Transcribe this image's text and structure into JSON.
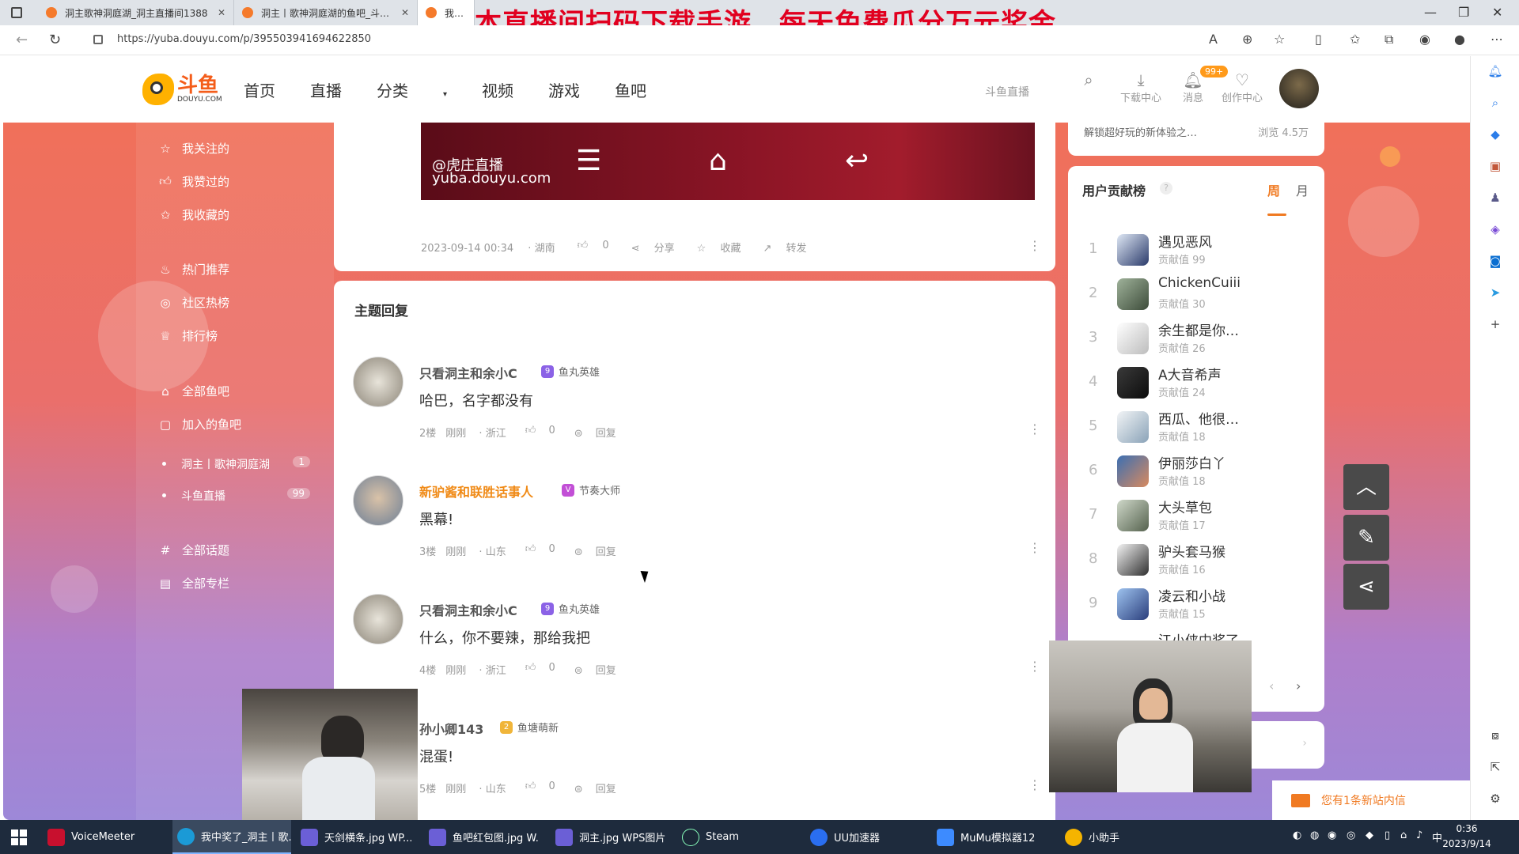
{
  "browser": {
    "tabs": [
      {
        "title": "洞主歌神洞庭湖_洞主直播间1388"
      },
      {
        "title": "洞主丨歌神洞庭湖的鱼吧_斗鱼鱼"
      },
      {
        "title": "我中奖了_洞"
      }
    ],
    "url": "https://yuba.douyu.com/p/395503941694622850",
    "overlay_banner": "本直播间扫码下载手游，每天免费瓜分万元奖金"
  },
  "header": {
    "logo_cn": "斗鱼",
    "logo_en": "DOUYU.COM",
    "nav": [
      "首页",
      "直播",
      "分类",
      "视频",
      "游戏",
      "鱼吧"
    ],
    "live_link": "斗鱼直播",
    "download_label": "下载中心",
    "message_label": "消息",
    "message_badge": "99+",
    "creator_label": "创作中心"
  },
  "sidebar": {
    "group1": [
      "我关注的",
      "我赞过的",
      "我收藏的"
    ],
    "group2": [
      "热门推荐",
      "社区热榜",
      "排行榜"
    ],
    "group3": [
      "全部鱼吧",
      "加入的鱼吧"
    ],
    "joined": [
      {
        "name": "洞主丨歌神洞庭湖",
        "count": "1"
      },
      {
        "name": "斗鱼直播",
        "count": "99"
      }
    ],
    "group4": [
      "全部话题",
      "全部专栏"
    ]
  },
  "post": {
    "watermark_1": "@虎庄直播",
    "watermark_2": "yuba.douyu.com",
    "time": "2023-09-14 00:34",
    "location": "湖南",
    "likes": "0",
    "share": "分享",
    "collect": "收藏",
    "forward": "转发"
  },
  "replies": {
    "title": "主题回复",
    "items": [
      {
        "name": "只看洞主和余小C",
        "badge": "鱼丸英雄",
        "text": "哈巴，名字都没有",
        "floor": "2楼",
        "time": "刚刚",
        "loc": "浙江",
        "likes": "0",
        "reply": "回复"
      },
      {
        "name": "新驴酱和联胜话事人",
        "badge": "节奏大师",
        "text": "黑幕!",
        "floor": "3楼",
        "time": "刚刚",
        "loc": "山东",
        "likes": "0",
        "reply": "回复"
      },
      {
        "name": "只看洞主和余小C",
        "badge": "鱼丸英雄",
        "text": "什么，你不要辣，那给我把",
        "floor": "4楼",
        "time": "刚刚",
        "loc": "浙江",
        "likes": "0",
        "reply": "回复"
      },
      {
        "name": "孙小卿143",
        "badge": "鱼塘萌新",
        "text": "混蛋!",
        "floor": "5楼",
        "time": "刚刚",
        "loc": "山东",
        "likes": "0",
        "reply": "回复"
      }
    ]
  },
  "right": {
    "top_text": "解锁超好玩的新体验之…",
    "top_views": "浏览 4.5万",
    "rank_title": "用户贡献榜",
    "tab_week": "周",
    "tab_month": "月",
    "value_prefix": "贡献值",
    "ranks": [
      {
        "num": "1",
        "name": "遇见恶风",
        "value": "99"
      },
      {
        "num": "2",
        "name": "ChickenCuiii",
        "value": "30"
      },
      {
        "num": "3",
        "name": "余生都是你…",
        "value": "26"
      },
      {
        "num": "4",
        "name": "A大音希声",
        "value": "24"
      },
      {
        "num": "5",
        "name": "西瓜、他很…",
        "value": "18"
      },
      {
        "num": "6",
        "name": "伊丽莎白丫",
        "value": "18"
      },
      {
        "num": "7",
        "name": "大头草包",
        "value": "17"
      },
      {
        "num": "8",
        "name": "驴头套马猴",
        "value": "16"
      },
      {
        "num": "9",
        "name": "凌云和小战",
        "value": "15"
      }
    ],
    "partial_rank": "江小侠中奖了"
  },
  "message_bar": "您有1条新站内信",
  "taskbar": {
    "items": [
      "VoiceMeeter",
      "我中奖了_洞主丨歌...",
      "天剑横条.jpg  WP...",
      "鱼吧红包图.jpg  W...",
      "洞主.jpg  WPS图片",
      "Steam",
      "UU加速器",
      "MuMu模拟器12",
      "小助手"
    ],
    "ime": "中",
    "time": "0:36",
    "date": "2023/9/14"
  }
}
